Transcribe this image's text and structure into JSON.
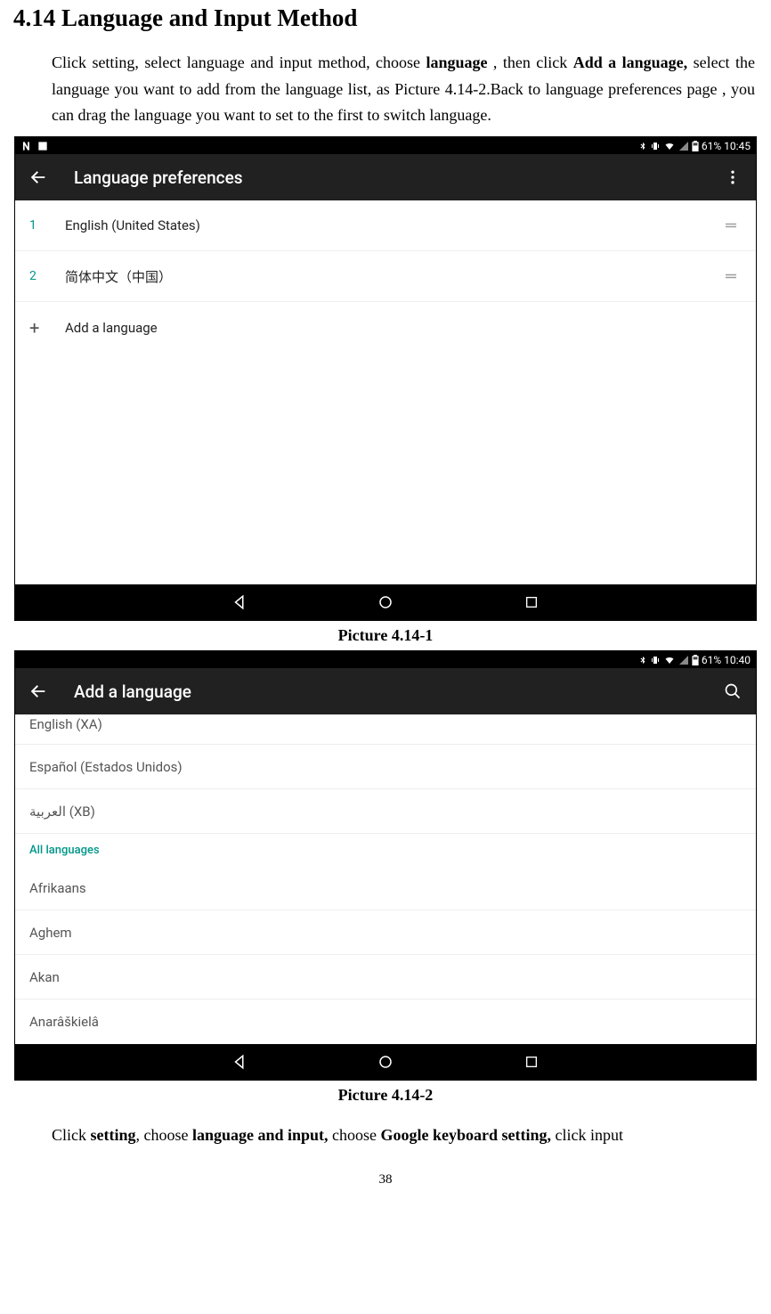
{
  "heading": "4.14    Language and Input Method",
  "para1_pre": "Click setting, select language and input method, choose ",
  "para1_b1": "language",
  "para1_mid": " , then click ",
  "para1_b2": "Add a language,",
  "para1_post": " select the language you want to add from the language list, as Picture 4.14-2.Back to language preferences page , you can drag the language you want to set to the first to switch language.",
  "caption1": "Picture 4.14-1",
  "caption2": "Picture 4.14-2",
  "para2_pre": "Click ",
  "para2_b1": "setting",
  "para2_mid1": ", choose ",
  "para2_b2": "language and input,",
  "para2_mid2": " choose ",
  "para2_b3": "Google keyboard setting,",
  "para2_post": " click input",
  "pagenum": "38",
  "shot1": {
    "status_left_icons": [
      "N",
      "picture"
    ],
    "status_battery": "61%",
    "status_time": "10:45",
    "title": "Language preferences",
    "rows": [
      {
        "idx": "1",
        "label": "English (United States)"
      },
      {
        "idx": "2",
        "label": "简体中文（中国）"
      }
    ],
    "add_label": "Add a language"
  },
  "shot2": {
    "status_battery": "61%",
    "status_time": "10:40",
    "title": "Add a language",
    "suggested": [
      "English (XA)",
      "Español (Estados Unidos)",
      "العربية (XB)"
    ],
    "section": "All languages",
    "all": [
      "Afrikaans",
      "Aghem",
      "Akan",
      "Anarâškielâ"
    ]
  }
}
